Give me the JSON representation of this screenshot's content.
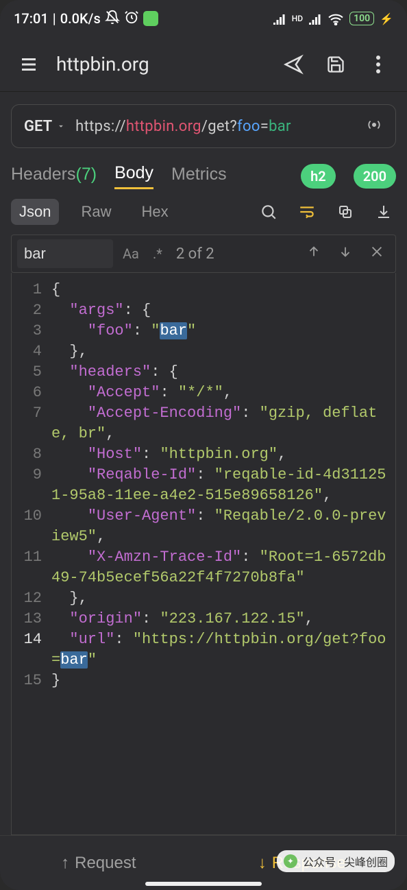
{
  "status_bar": {
    "time": "17:01",
    "net_speed": "0.0K/s",
    "hd_label": "HD",
    "battery_pct": "100"
  },
  "app_header": {
    "title": "httpbin.org"
  },
  "request": {
    "method": "GET",
    "url_scheme": "https://",
    "url_host": "httpbin.org",
    "url_path": "/get",
    "url_qmark": "?",
    "url_qkey": "foo",
    "url_eq": "=",
    "url_qval": "bar"
  },
  "main_tabs": {
    "headers_label": "Headers",
    "headers_count": "(7)",
    "body_label": "Body",
    "metrics_label": "Metrics",
    "badge_protocol": "h2",
    "badge_status": "200"
  },
  "fmt_tabs": {
    "json": "Json",
    "raw": "Raw",
    "hex": "Hex"
  },
  "search": {
    "query": "bar",
    "opt_case": "Aa",
    "opt_regex": ".*",
    "counter": "2 of 2"
  },
  "code_lines": [
    {
      "n": "1",
      "segments": [
        {
          "t": "{",
          "c": "punc"
        }
      ]
    },
    {
      "n": "2",
      "segments": [
        {
          "t": "  ",
          "c": "punc"
        },
        {
          "t": "\"args\"",
          "c": "key"
        },
        {
          "t": ": {",
          "c": "punc"
        }
      ]
    },
    {
      "n": "3",
      "segments": [
        {
          "t": "    ",
          "c": "punc"
        },
        {
          "t": "\"foo\"",
          "c": "key"
        },
        {
          "t": ": ",
          "c": "punc"
        },
        {
          "t": "\"",
          "c": "str"
        },
        {
          "t": "bar",
          "c": "str hl"
        },
        {
          "t": "\"",
          "c": "str"
        }
      ]
    },
    {
      "n": "4",
      "segments": [
        {
          "t": "  },",
          "c": "punc"
        }
      ]
    },
    {
      "n": "5",
      "segments": [
        {
          "t": "  ",
          "c": "punc"
        },
        {
          "t": "\"headers\"",
          "c": "key"
        },
        {
          "t": ": {",
          "c": "punc"
        }
      ]
    },
    {
      "n": "6",
      "segments": [
        {
          "t": "    ",
          "c": "punc"
        },
        {
          "t": "\"Accept\"",
          "c": "key"
        },
        {
          "t": ": ",
          "c": "punc"
        },
        {
          "t": "\"*/*\"",
          "c": "str"
        },
        {
          "t": ",",
          "c": "punc"
        }
      ]
    },
    {
      "n": "7",
      "segments": [
        {
          "t": "    ",
          "c": "punc"
        },
        {
          "t": "\"Accept-Encoding\"",
          "c": "key"
        },
        {
          "t": ": ",
          "c": "punc"
        },
        {
          "t": "\"gzip, deflate, br\"",
          "c": "str"
        },
        {
          "t": ",",
          "c": "punc"
        }
      ]
    },
    {
      "n": "8",
      "segments": [
        {
          "t": "    ",
          "c": "punc"
        },
        {
          "t": "\"Host\"",
          "c": "key"
        },
        {
          "t": ": ",
          "c": "punc"
        },
        {
          "t": "\"httpbin.org\"",
          "c": "str"
        },
        {
          "t": ",",
          "c": "punc"
        }
      ]
    },
    {
      "n": "9",
      "segments": [
        {
          "t": "    ",
          "c": "punc"
        },
        {
          "t": "\"Reqable-Id\"",
          "c": "key"
        },
        {
          "t": ": ",
          "c": "punc"
        },
        {
          "t": "\"reqable-id-4d311251-95a8-11ee-a4e2-515e89658126\"",
          "c": "str"
        },
        {
          "t": ",",
          "c": "punc"
        }
      ]
    },
    {
      "n": "10",
      "segments": [
        {
          "t": "    ",
          "c": "punc"
        },
        {
          "t": "\"User-Agent\"",
          "c": "key"
        },
        {
          "t": ": ",
          "c": "punc"
        },
        {
          "t": "\"Reqable/2.0.0-preview5\"",
          "c": "str"
        },
        {
          "t": ",",
          "c": "punc"
        }
      ]
    },
    {
      "n": "11",
      "segments": [
        {
          "t": "    ",
          "c": "punc"
        },
        {
          "t": "\"X-Amzn-Trace-Id\"",
          "c": "key"
        },
        {
          "t": ": ",
          "c": "punc"
        },
        {
          "t": "\"Root=1-6572db49-74b5ecef56a22f4f7270b8fa\"",
          "c": "str"
        }
      ]
    },
    {
      "n": "12",
      "segments": [
        {
          "t": "  },",
          "c": "punc"
        }
      ]
    },
    {
      "n": "13",
      "segments": [
        {
          "t": "  ",
          "c": "punc"
        },
        {
          "t": "\"origin\"",
          "c": "key"
        },
        {
          "t": ": ",
          "c": "punc"
        },
        {
          "t": "\"223.167.122.15\"",
          "c": "str"
        },
        {
          "t": ",",
          "c": "punc"
        }
      ]
    },
    {
      "n": "14",
      "cur": true,
      "segments": [
        {
          "t": "  ",
          "c": "punc"
        },
        {
          "t": "\"url\"",
          "c": "key"
        },
        {
          "t": ": ",
          "c": "punc"
        },
        {
          "t": "\"https://httpbin.org/get?foo=",
          "c": "str"
        },
        {
          "t": "bar",
          "c": "str hl"
        },
        {
          "t": "\"",
          "c": "str"
        }
      ]
    },
    {
      "n": "15",
      "segments": [
        {
          "t": "}",
          "c": "punc"
        }
      ]
    }
  ],
  "bottom": {
    "request": "Request",
    "response": "Response",
    "up": "↑",
    "down": "↓"
  },
  "watermark": {
    "label": "公众号 · 尖峰创圈"
  }
}
